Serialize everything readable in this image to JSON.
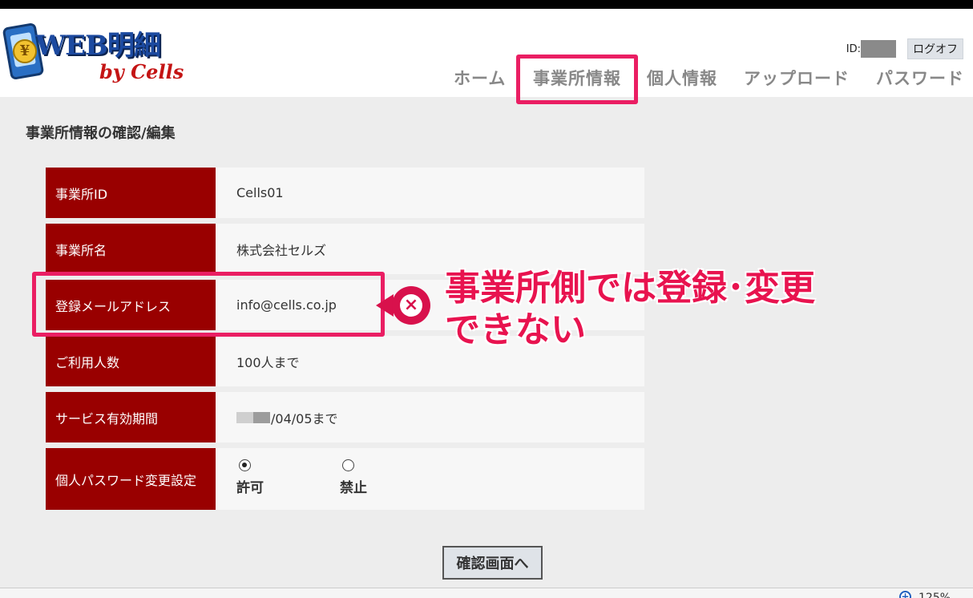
{
  "logo": {
    "main": "WEB明細",
    "sub": "by Cells",
    "coin": "¥"
  },
  "header": {
    "id_label": "ID:",
    "logout_label": "ログオフ"
  },
  "nav": {
    "items": [
      "ホーム",
      "事業所情報",
      "個人情報",
      "アップロード",
      "パスワード"
    ],
    "active": "事業所情報"
  },
  "page": {
    "title": "事業所情報の確認/編集"
  },
  "form": {
    "rows": [
      {
        "label": "事業所ID",
        "value": "Cells01"
      },
      {
        "label": "事業所名",
        "value": "株式会社セルズ"
      },
      {
        "label": "登録メールアドレス",
        "value": "info@cells.co.jp"
      },
      {
        "label": "ご利用人数",
        "value": "100人まで"
      },
      {
        "label": "サービス有効期間",
        "value": "/04/05まで"
      },
      {
        "label": "個人パスワード変更設定",
        "value": ""
      }
    ],
    "password_options": [
      {
        "label": "許可",
        "checked": true
      },
      {
        "label": "禁止",
        "checked": false
      }
    ]
  },
  "annotation": {
    "icon": "×",
    "line1": "事業所側では登録･変更",
    "line2": "できない"
  },
  "confirm_button": "確認画面へ",
  "status": {
    "zoom": "125%"
  },
  "colors": {
    "label_bg": "#990000",
    "highlight": "#ea1e63",
    "annotation_text": "#e8134f"
  }
}
